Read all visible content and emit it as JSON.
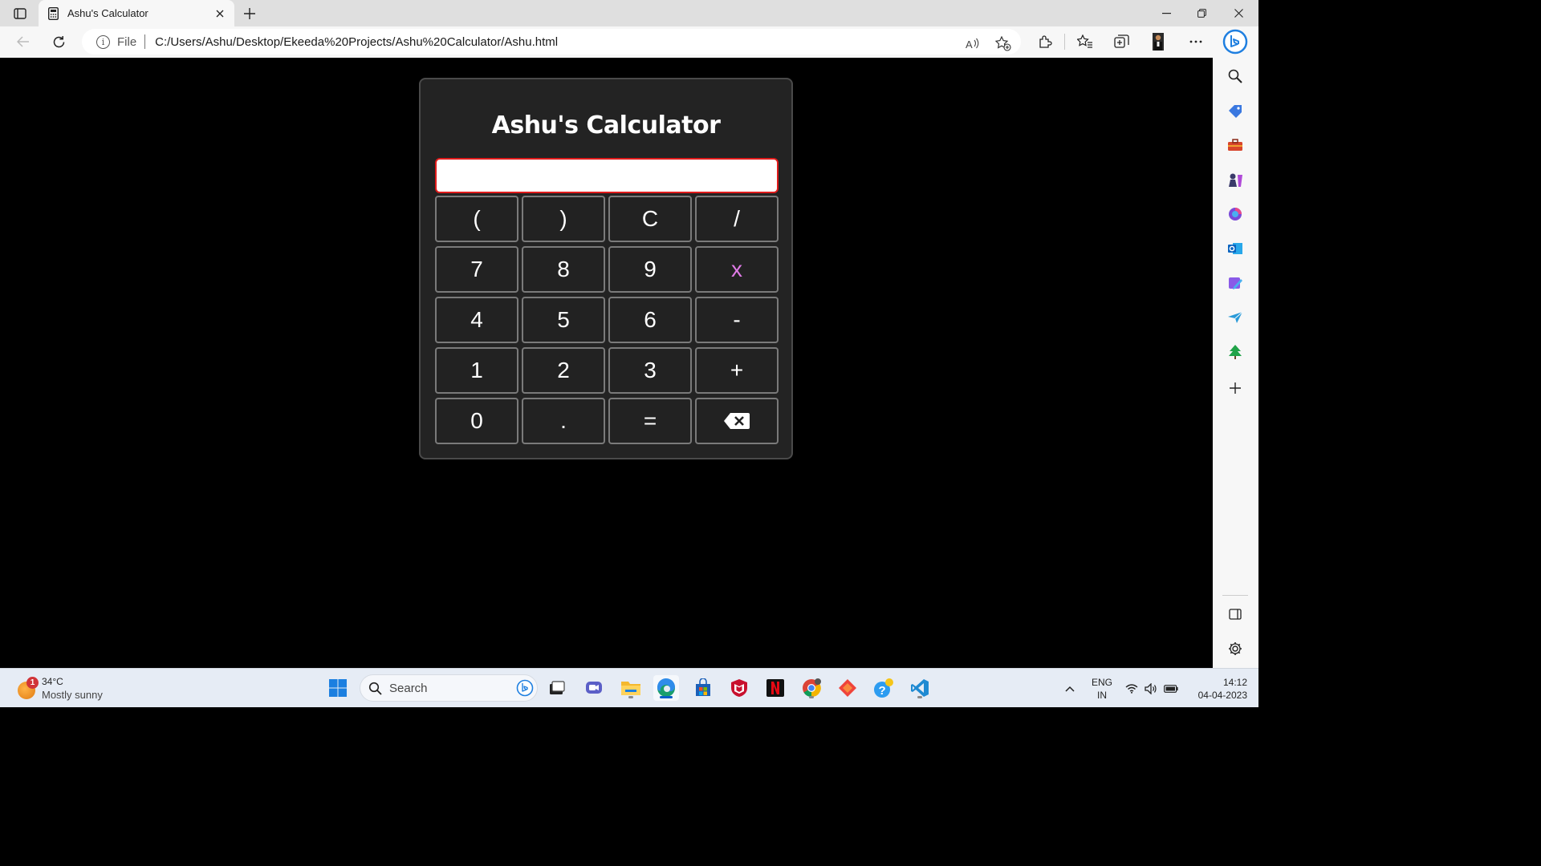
{
  "browser": {
    "tab_title": "Ashu's Calculator",
    "address_scheme": "File",
    "address_url": "C:/Users/Ashu/Desktop/Ekeeda%20Projects/Ashu%20Calculator/Ashu.html"
  },
  "calculator": {
    "title": "Ashu's Calculator",
    "display_value": "",
    "keys": [
      "(",
      ")",
      "C",
      "/",
      "7",
      "8",
      "9",
      "x",
      "4",
      "5",
      "6",
      "-",
      "1",
      "2",
      "3",
      "+",
      "0",
      ".",
      "=",
      "backspace"
    ],
    "accent_color": "#e01b1b",
    "multiply_color": "#e07be7"
  },
  "sidebar": {
    "icons": [
      "search-icon",
      "tag-icon",
      "toolbox-icon",
      "games-icon",
      "office-icon",
      "outlook-icon",
      "designer-icon",
      "send-icon",
      "tree-icon",
      "add-icon"
    ]
  },
  "taskbar": {
    "weather_temp": "34°C",
    "weather_desc": "Mostly sunny",
    "weather_badge": "1",
    "search_label": "Search",
    "lang_line1": "ENG",
    "lang_line2": "IN",
    "time": "14:12",
    "date": "04-04-2023"
  }
}
